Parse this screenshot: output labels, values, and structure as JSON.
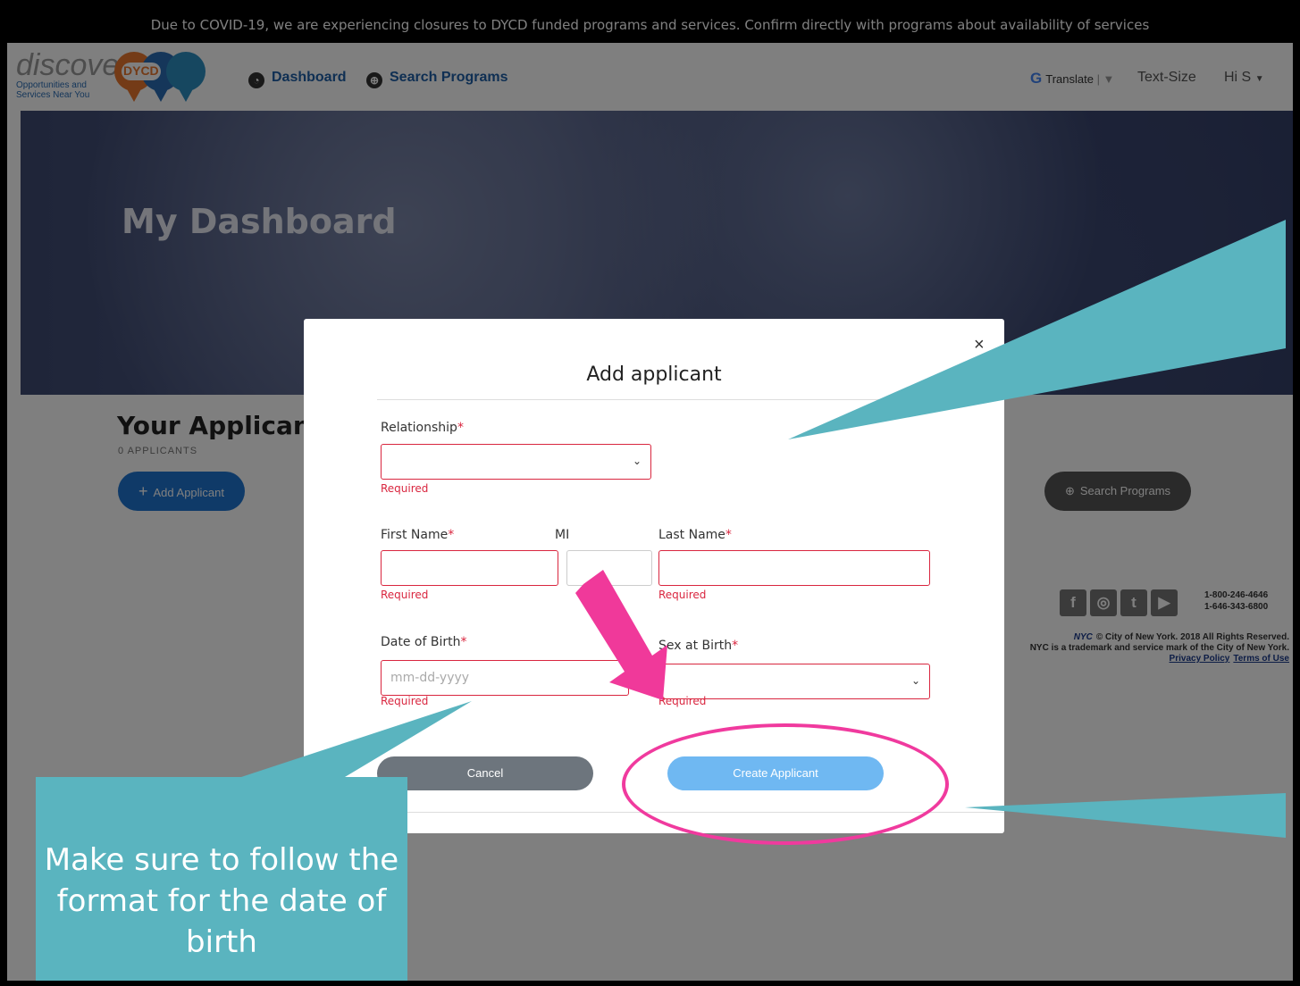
{
  "banner": {
    "text": "Due to COVID-19, we are experiencing closures to DYCD funded programs and services. Confirm directly with programs about availability of services"
  },
  "header": {
    "logo_word": "discover",
    "logo_badge": "DYCD",
    "logo_sub": "Opportunities and Services Near You",
    "nav": {
      "dashboard": "Dashboard",
      "search_programs": "Search Programs"
    },
    "translate": "Translate",
    "text_size": "Text-Size",
    "user": "Hi S"
  },
  "hero": {
    "title": "My Dashboard"
  },
  "applicants": {
    "title": "Your Applicants",
    "count": "0 APPLICANTS",
    "add_button": "Add Applicant",
    "search_button": "Search Programs"
  },
  "footer": {
    "phone1": "1-800-246-4646",
    "phone2": "1-646-343-6800",
    "nyc": "NYC",
    "copyright": "© City of New York. 2018 All Rights Reserved.",
    "trademark": "NYC is a trademark and service mark of the City of New York.",
    "privacy": "Privacy Policy",
    "terms": "Terms of Use"
  },
  "modal": {
    "title": "Add applicant",
    "close": "×",
    "relationship_label": "Relationship",
    "first_name_label": "First Name",
    "mi_label": "MI",
    "last_name_label": "Last Name",
    "dob_label": "Date of Birth",
    "dob_placeholder": "mm-dd-yyyy",
    "sex_label": "Sex at Birth",
    "required_marker": "*",
    "required_text": "Required",
    "cancel_button": "Cancel",
    "create_button": "Create Applicant"
  },
  "annotation": {
    "callout_text": "Make sure to follow the format for the date of birth"
  },
  "colors": {
    "callout": "#5ab4bf",
    "highlight_pink": "#f03a9e",
    "primary_blue": "#1f75d0",
    "error_red": "#d9263f"
  }
}
